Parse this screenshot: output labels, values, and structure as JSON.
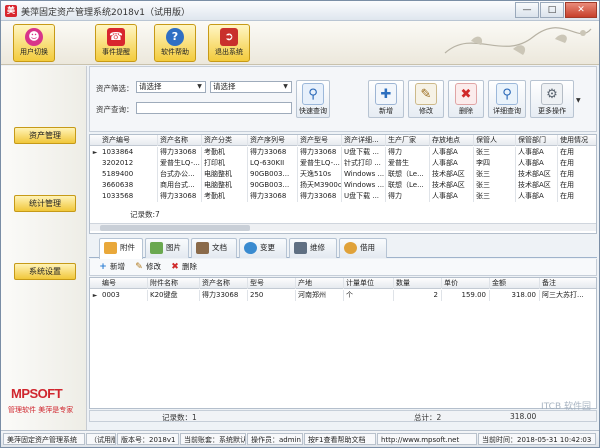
{
  "window": {
    "title": "美萍固定资产管理系统2018v1（试用版）",
    "controls": [
      "minimize",
      "maximize",
      "close"
    ]
  },
  "toolbar": {
    "buttons": [
      {
        "label": "用户切换",
        "icon": "user-switch-icon"
      },
      {
        "label": "事件提醒",
        "icon": "alarm-icon"
      },
      {
        "label": "软件帮助",
        "icon": "help-icon"
      },
      {
        "label": "退出系统",
        "icon": "exit-icon"
      }
    ]
  },
  "sidebar": {
    "items": [
      {
        "label": "资产管理"
      },
      {
        "label": "统计管理"
      },
      {
        "label": "系统设置"
      }
    ],
    "logo": "MPSOFT",
    "logo_tagline": "管理软件   美萍是专家"
  },
  "search": {
    "filter_label": "资产筛选：",
    "filter1_value": "请选择",
    "filter2_value": "请选择",
    "query_label": "资产查询：",
    "query_value": "",
    "quick_query_label": "快速查询",
    "actions": [
      {
        "label": "新增",
        "icon": "new-doc-icon"
      },
      {
        "label": "修改",
        "icon": "edit-icon"
      },
      {
        "label": "删除",
        "icon": "delete-icon"
      },
      {
        "label": "详细查询",
        "icon": "detail-search-icon"
      },
      {
        "label": "更多操作",
        "icon": "gear-icon"
      }
    ]
  },
  "asset_table": {
    "columns": [
      "资产编号",
      "资产名称",
      "资产分类",
      "资产序列号",
      "资产型号",
      "资产详细...",
      "生产厂家",
      "存放地点",
      "保管人",
      "保管部门",
      "使用情况"
    ],
    "rows": [
      [
        "1033864",
        "得力33068",
        "考勤机",
        "得力33068",
        "得力33068",
        "U盘下载 ...",
        "得力",
        "人事部A",
        "张三",
        "人事部A",
        "在用"
      ],
      [
        "3202012",
        "爱普生LQ-...",
        "打印机",
        "LQ-630KII",
        "爱普生LQ-...",
        "针式打印 ...",
        "爱普生",
        "人事部A",
        "李四",
        "人事部A",
        "在用"
      ],
      [
        "5189400",
        "台式办公...",
        "电脑整机",
        "90GB003...",
        "天逸510s",
        "Windows ...",
        "联想（Le...",
        "技术部A区",
        "张三",
        "技术部A区",
        "在用"
      ],
      [
        "3660638",
        "商用台式...",
        "电脑整机",
        "90GB003...",
        "扬天M3900c",
        "Windows ...",
        "联想（Le...",
        "技术部A区",
        "张三",
        "技术部A区",
        "在用"
      ],
      [
        "1033568",
        "得力33068",
        "考勤机",
        "得力33068",
        "得力33068",
        "U盘下载 ...",
        "得力",
        "人事部A",
        "张三",
        "人事部A",
        "在用"
      ]
    ],
    "selected_row": 0,
    "record_count": "记录数:7"
  },
  "detail_tabs": {
    "items": [
      {
        "label": "附件",
        "active": true
      },
      {
        "label": "图片",
        "active": false
      },
      {
        "label": "文档",
        "active": false
      },
      {
        "label": "变更",
        "active": false
      },
      {
        "label": "维修",
        "active": false
      },
      {
        "label": "借用",
        "active": false
      }
    ],
    "sub_actions": [
      {
        "label": "新增",
        "icon": "plus-icon"
      },
      {
        "label": "修改",
        "icon": "pencil-icon"
      },
      {
        "label": "删除",
        "icon": "x-icon"
      }
    ]
  },
  "attachment_table": {
    "columns": [
      "编号",
      "附件名称",
      "资产名称",
      "型号",
      "产地",
      "计量单位",
      "数量",
      "单价",
      "金额",
      "备注"
    ],
    "rows": [
      [
        "0003",
        "K20键盘",
        "得力33068",
        "250",
        "河南郑州",
        "个",
        "2",
        "159.00",
        "318.00",
        "阿三大苏打..."
      ]
    ],
    "footer": {
      "record_count": "记录数：1",
      "total_label": "总计：2",
      "amount_total": "318.00"
    }
  },
  "statusbar": {
    "items": [
      "美萍固定资产管理系统",
      "（试用版）",
      "版本号：2018v1",
      "当前账套：系统默认",
      "操作员：admin",
      "按F1查看帮助文档",
      "http://www.mpsoft.net",
      "当前时间：2018-05-31 10:42:03"
    ]
  },
  "watermark": "ITCB 软件园"
}
